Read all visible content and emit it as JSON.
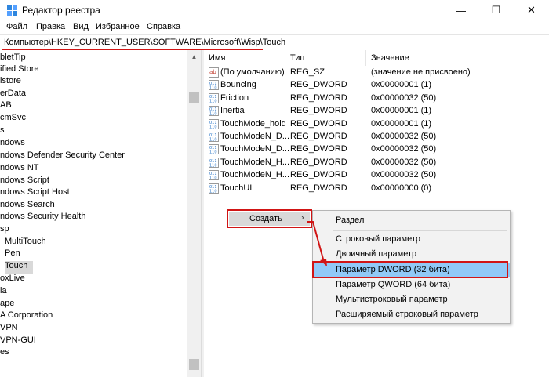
{
  "window": {
    "title": "Редактор реестра",
    "controls": {
      "minimize": "—",
      "maximize": "☐",
      "close": "✕"
    }
  },
  "menu": [
    "Файл",
    "Правка",
    "Вид",
    "Избранное",
    "Справка"
  ],
  "address": "Компьютер\\HKEY_CURRENT_USER\\SOFTWARE\\Microsoft\\Wisp\\Touch",
  "tree": [
    "bletTip",
    "ified Store",
    "istore",
    "erData",
    "AB",
    "cmSvc",
    "s",
    "ndows",
    "ndows Defender Security Center",
    "ndows NT",
    "ndows Script",
    "ndows Script Host",
    "ndows Search",
    "ndows Security Health",
    "sp",
    "MultiTouch",
    "Pen",
    "Touch",
    "oxLive",
    "la",
    "ape",
    "A Corporation",
    "VPN",
    "VPN-GUI",
    "es"
  ],
  "tree_selected": "Touch",
  "columns": {
    "name": "Имя",
    "type": "Тип",
    "value": "Значение"
  },
  "values": [
    {
      "name": "(По умолчанию)",
      "type": "REG_SZ",
      "data": "(значение не присвоено)",
      "icon": "string-value-icon"
    },
    {
      "name": "Bouncing",
      "type": "REG_DWORD",
      "data": "0x00000001 (1)",
      "icon": "binary-value-icon"
    },
    {
      "name": "Friction",
      "type": "REG_DWORD",
      "data": "0x00000032 (50)",
      "icon": "binary-value-icon"
    },
    {
      "name": "Inertia",
      "type": "REG_DWORD",
      "data": "0x00000001 (1)",
      "icon": "binary-value-icon"
    },
    {
      "name": "TouchMode_hold",
      "type": "REG_DWORD",
      "data": "0x00000001 (1)",
      "icon": "binary-value-icon"
    },
    {
      "name": "TouchModeN_D...",
      "type": "REG_DWORD",
      "data": "0x00000032 (50)",
      "icon": "binary-value-icon"
    },
    {
      "name": "TouchModeN_D...",
      "type": "REG_DWORD",
      "data": "0x00000032 (50)",
      "icon": "binary-value-icon"
    },
    {
      "name": "TouchModeN_H...",
      "type": "REG_DWORD",
      "data": "0x00000032 (50)",
      "icon": "binary-value-icon"
    },
    {
      "name": "TouchModeN_H...",
      "type": "REG_DWORD",
      "data": "0x00000032 (50)",
      "icon": "binary-value-icon"
    },
    {
      "name": "TouchUI",
      "type": "REG_DWORD",
      "data": "0x00000000 (0)",
      "icon": "binary-value-icon"
    }
  ],
  "context_menu": {
    "create_label": "Создать",
    "submenu_arrow": "›",
    "items": [
      "Раздел",
      "Строковый параметр",
      "Двоичный параметр",
      "Параметр DWORD (32 бита)",
      "Параметр QWORD (64 бита)",
      "Мультистроковый параметр",
      "Расширяемый строковый параметр"
    ],
    "highlighted": "Параметр DWORD (32 бита)"
  },
  "colors": {
    "annotation_red": "#d11515",
    "highlight_blue": "#91c9f7",
    "selection_gray": "#d9d9d9",
    "icon_blue": "#1f6fc6"
  }
}
